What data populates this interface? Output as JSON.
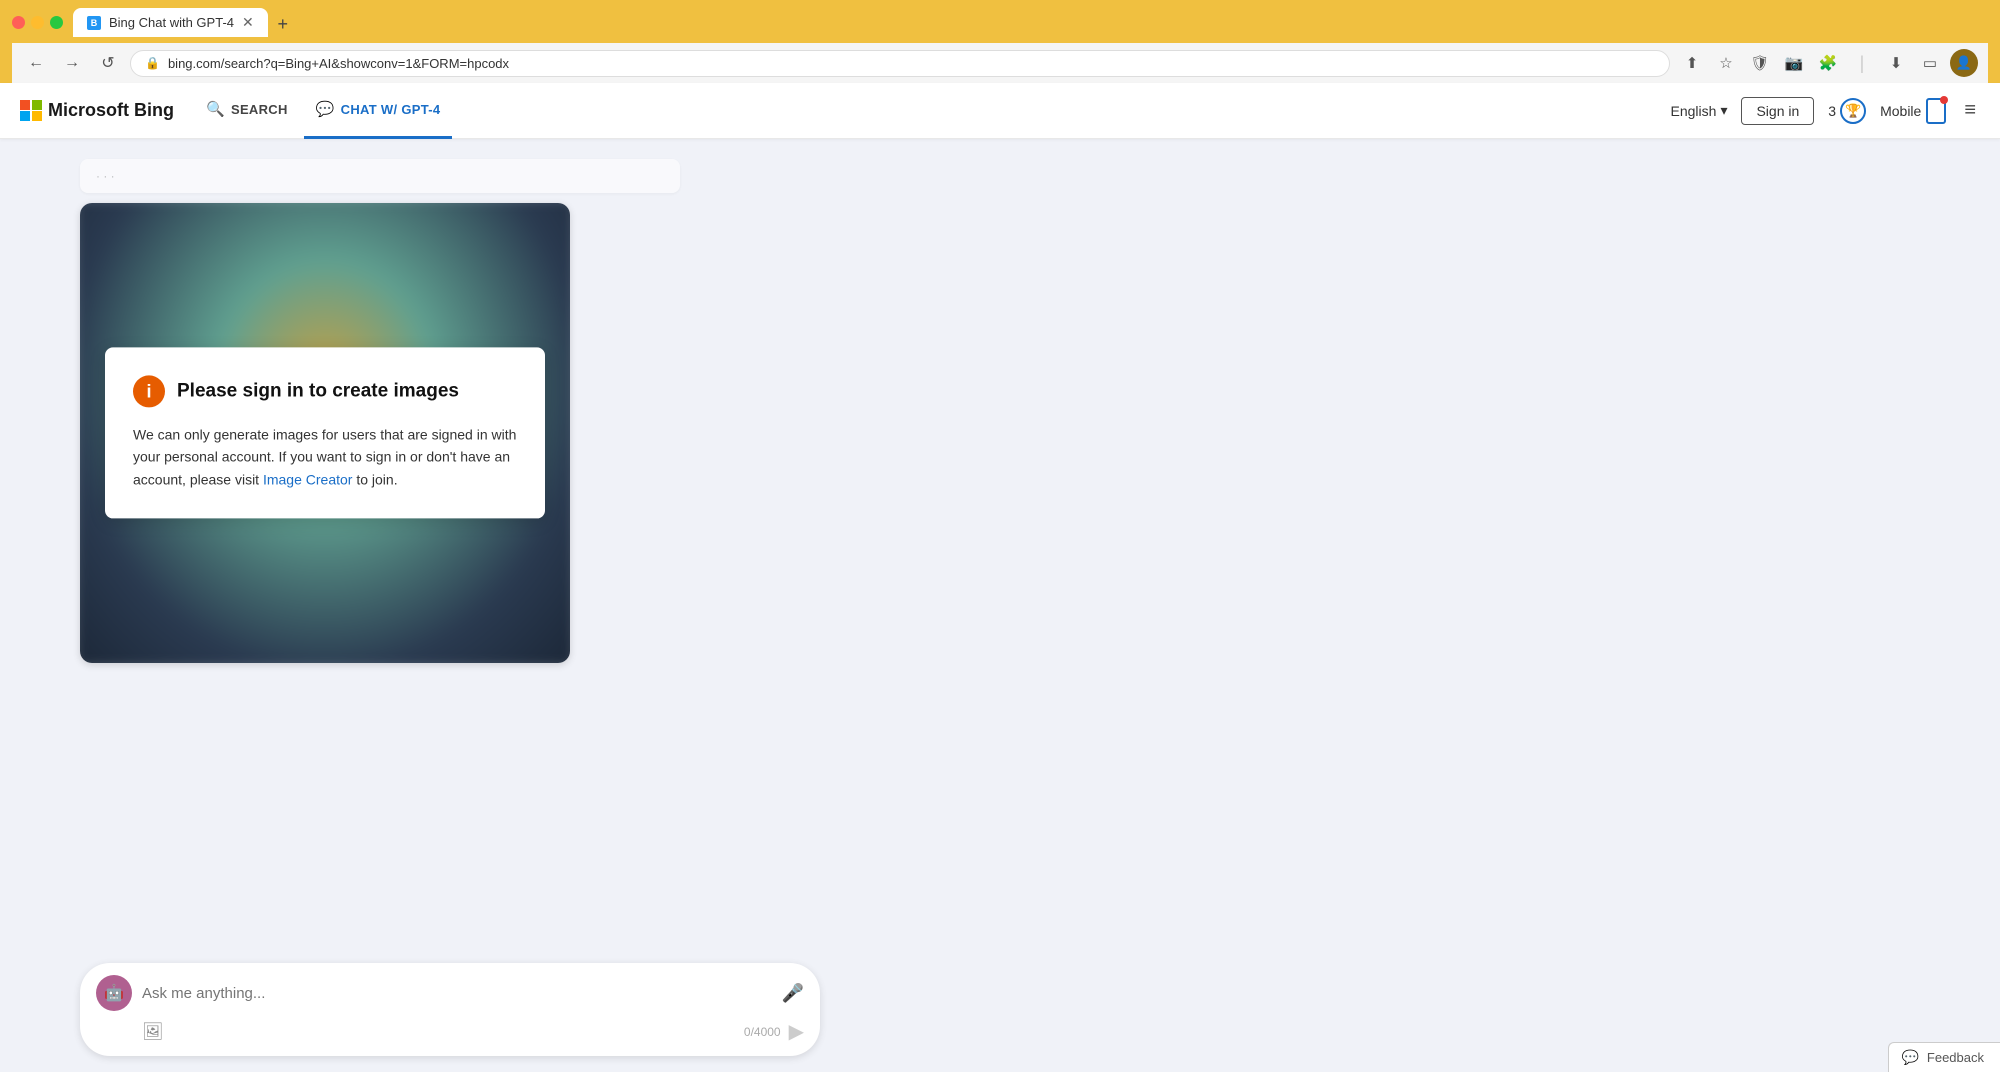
{
  "browser": {
    "tab_title": "Bing Chat with GPT-4",
    "tab_new_label": "+",
    "url": "bing.com/search?q=Bing+AI&showconv=1&FORM=hpcodx",
    "nav_back": "←",
    "nav_forward": "→",
    "nav_refresh": "↺"
  },
  "header": {
    "logo_text": "Microsoft Bing",
    "nav_items": [
      {
        "id": "search",
        "label": "SEARCH",
        "icon": "🔍",
        "active": false
      },
      {
        "id": "chat",
        "label": "CHAT w/ GPT-4",
        "icon": "💬",
        "active": true
      }
    ],
    "language": "English",
    "sign_in": "Sign in",
    "rewards_count": "3",
    "mobile_label": "Mobile",
    "menu_icon": "≡"
  },
  "chat": {
    "image_card": {
      "title": "Please sign in to create images",
      "info_icon": "i",
      "description_before_link": "We can only generate images for users that are signed in with your personal account. If you want to sign in or don't have an account, please visit ",
      "link_text": "Image Creator",
      "description_after_link": " to join."
    },
    "input": {
      "placeholder": "Ask me anything...",
      "char_count": "0/4000",
      "avatar_icon": "🤖"
    }
  },
  "feedback": {
    "label": "Feedback",
    "icon": "💬"
  }
}
